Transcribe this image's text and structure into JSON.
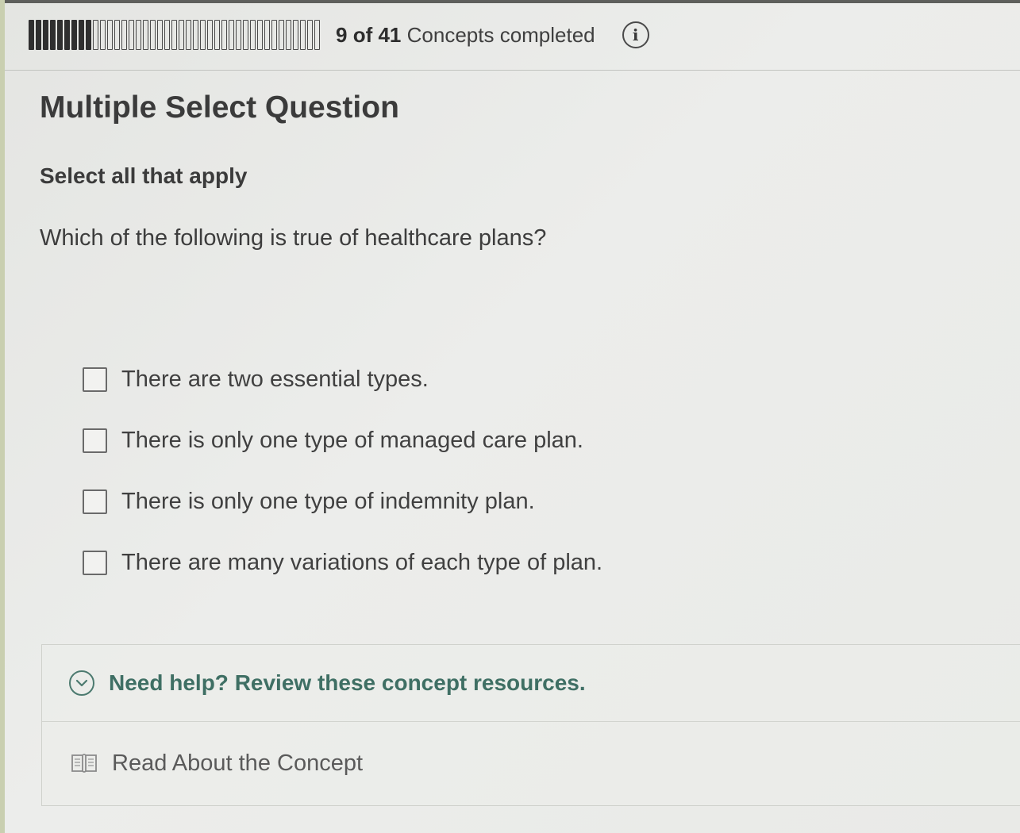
{
  "progress": {
    "completed": 9,
    "total": 41,
    "current": "9",
    "of_total": "of 41",
    "label": "Concepts completed"
  },
  "question": {
    "type_heading": "Multiple Select Question",
    "instruction": "Select all that apply",
    "prompt": "Which of the following is true of healthcare plans?"
  },
  "options": [
    {
      "label": "There are two essential types.",
      "checked": false
    },
    {
      "label": "There is only one type of managed care plan.",
      "checked": false
    },
    {
      "label": "There is only one type of indemnity plan.",
      "checked": false
    },
    {
      "label": "There are many variations of each type of plan.",
      "checked": false
    }
  ],
  "help": {
    "toggle_label": "Need help? Review these concept resources.",
    "resource_label": "Read About the Concept"
  },
  "icons": {
    "info": "info-icon",
    "chevron": "chevron-down-circle-icon",
    "book": "book-icon"
  },
  "colors": {
    "help_text": "#3f6f64",
    "progress_filled": "#2f2f2f"
  }
}
